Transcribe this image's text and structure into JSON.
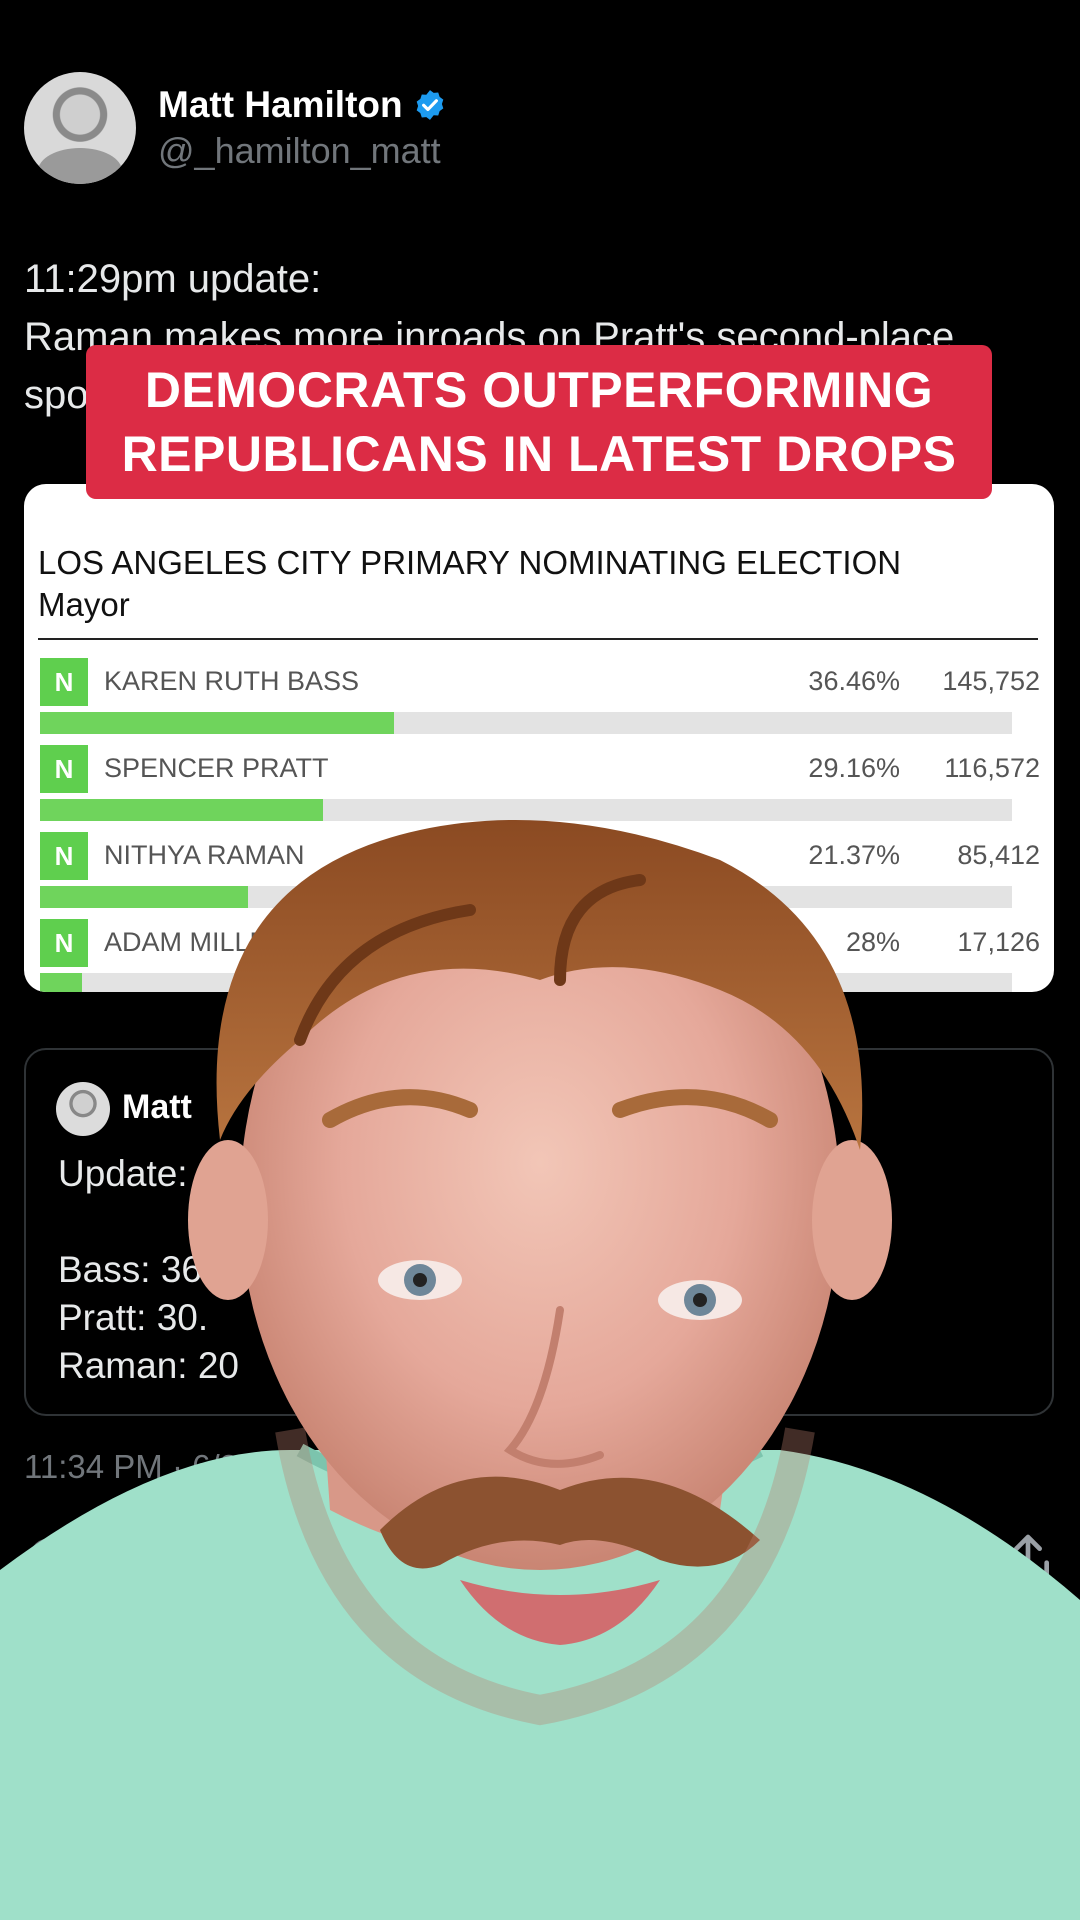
{
  "profile": {
    "display_name": "Matt Hamilton",
    "handle": "@_hamilton_matt",
    "verified": true
  },
  "post": {
    "line1": "11:29pm update:",
    "line2": "Raman makes more inroads on Pratt's second-place",
    "line3": "spo"
  },
  "banner": {
    "line1": "DEMOCRATS OUTPERFORMING",
    "line2": "REPUBLICANS IN LATEST DROPS",
    "color": "#dc2c45"
  },
  "results": {
    "title": "LOS ANGELES CITY PRIMARY NOMINATING ELECTION",
    "subtitle": "Mayor",
    "candidates": [
      {
        "badge": "N",
        "name": "KAREN RUTH BASS",
        "percent": "36.46%",
        "votes": "145,752",
        "share": 0.3646
      },
      {
        "badge": "N",
        "name": "SPENCER PRATT",
        "percent": "29.16%",
        "votes": "116,572",
        "share": 0.2916
      },
      {
        "badge": "N",
        "name": "NITHYA RAMAN",
        "percent": "21.37%",
        "votes": "85,412",
        "share": 0.2137
      },
      {
        "badge": "N",
        "name": "ADAM MILLER",
        "percent": "28%",
        "votes": "17,126",
        "share": 0.0428
      }
    ]
  },
  "quoted": {
    "name": "Matt",
    "line1": "Update:",
    "line2": "Bass: 36.5",
    "line3": "Pratt: 30.",
    "line4": "Raman: 20"
  },
  "timestamp": "11:34 PM · 6/2/2",
  "icons": {
    "reply": "reply-icon",
    "share": "share-icon",
    "verified": "verified-badge-icon"
  }
}
